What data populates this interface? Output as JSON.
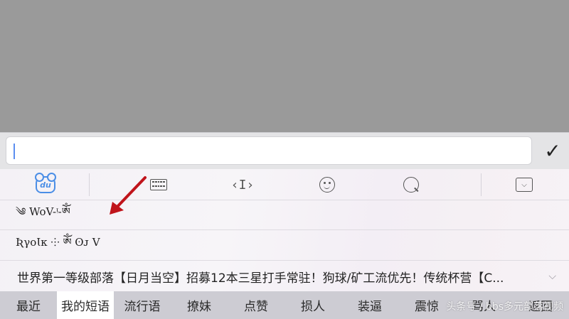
{
  "input": {
    "value": "",
    "confirm_glyph": "✓"
  },
  "toolbar": {
    "icons": [
      "du-logo-icon",
      "keyboard-icon",
      "cursor-icon",
      "emoji-icon",
      "search-icon",
      "collapse-keyboard-icon"
    ],
    "du_label": "du",
    "cursor_glyph": "‹I›",
    "collapse_glyph": "⌵"
  },
  "candidates": [
    "༄ WoV-ᵎ-ༀ",
    "ƦγοƖᴋ ⸭ ༀ ʘᴊ V"
  ],
  "phrase_line": "世界第一等级部落【日月当空】招募12本三星打手常驻！狗球/矿工流优先！传统杯营【C...",
  "tabs": [
    "最近",
    "我的短语",
    "流行语",
    "撩妹",
    "点赞",
    "损人",
    "装逼",
    "震惊",
    "骂人",
    "返回"
  ],
  "active_tab": "我的短语",
  "watermark": "头条号 / bbs多元部落视频",
  "colors": {
    "accent": "#4a8ee6",
    "arrow": "#c0141b",
    "tab_bar": "#cdccd3"
  }
}
